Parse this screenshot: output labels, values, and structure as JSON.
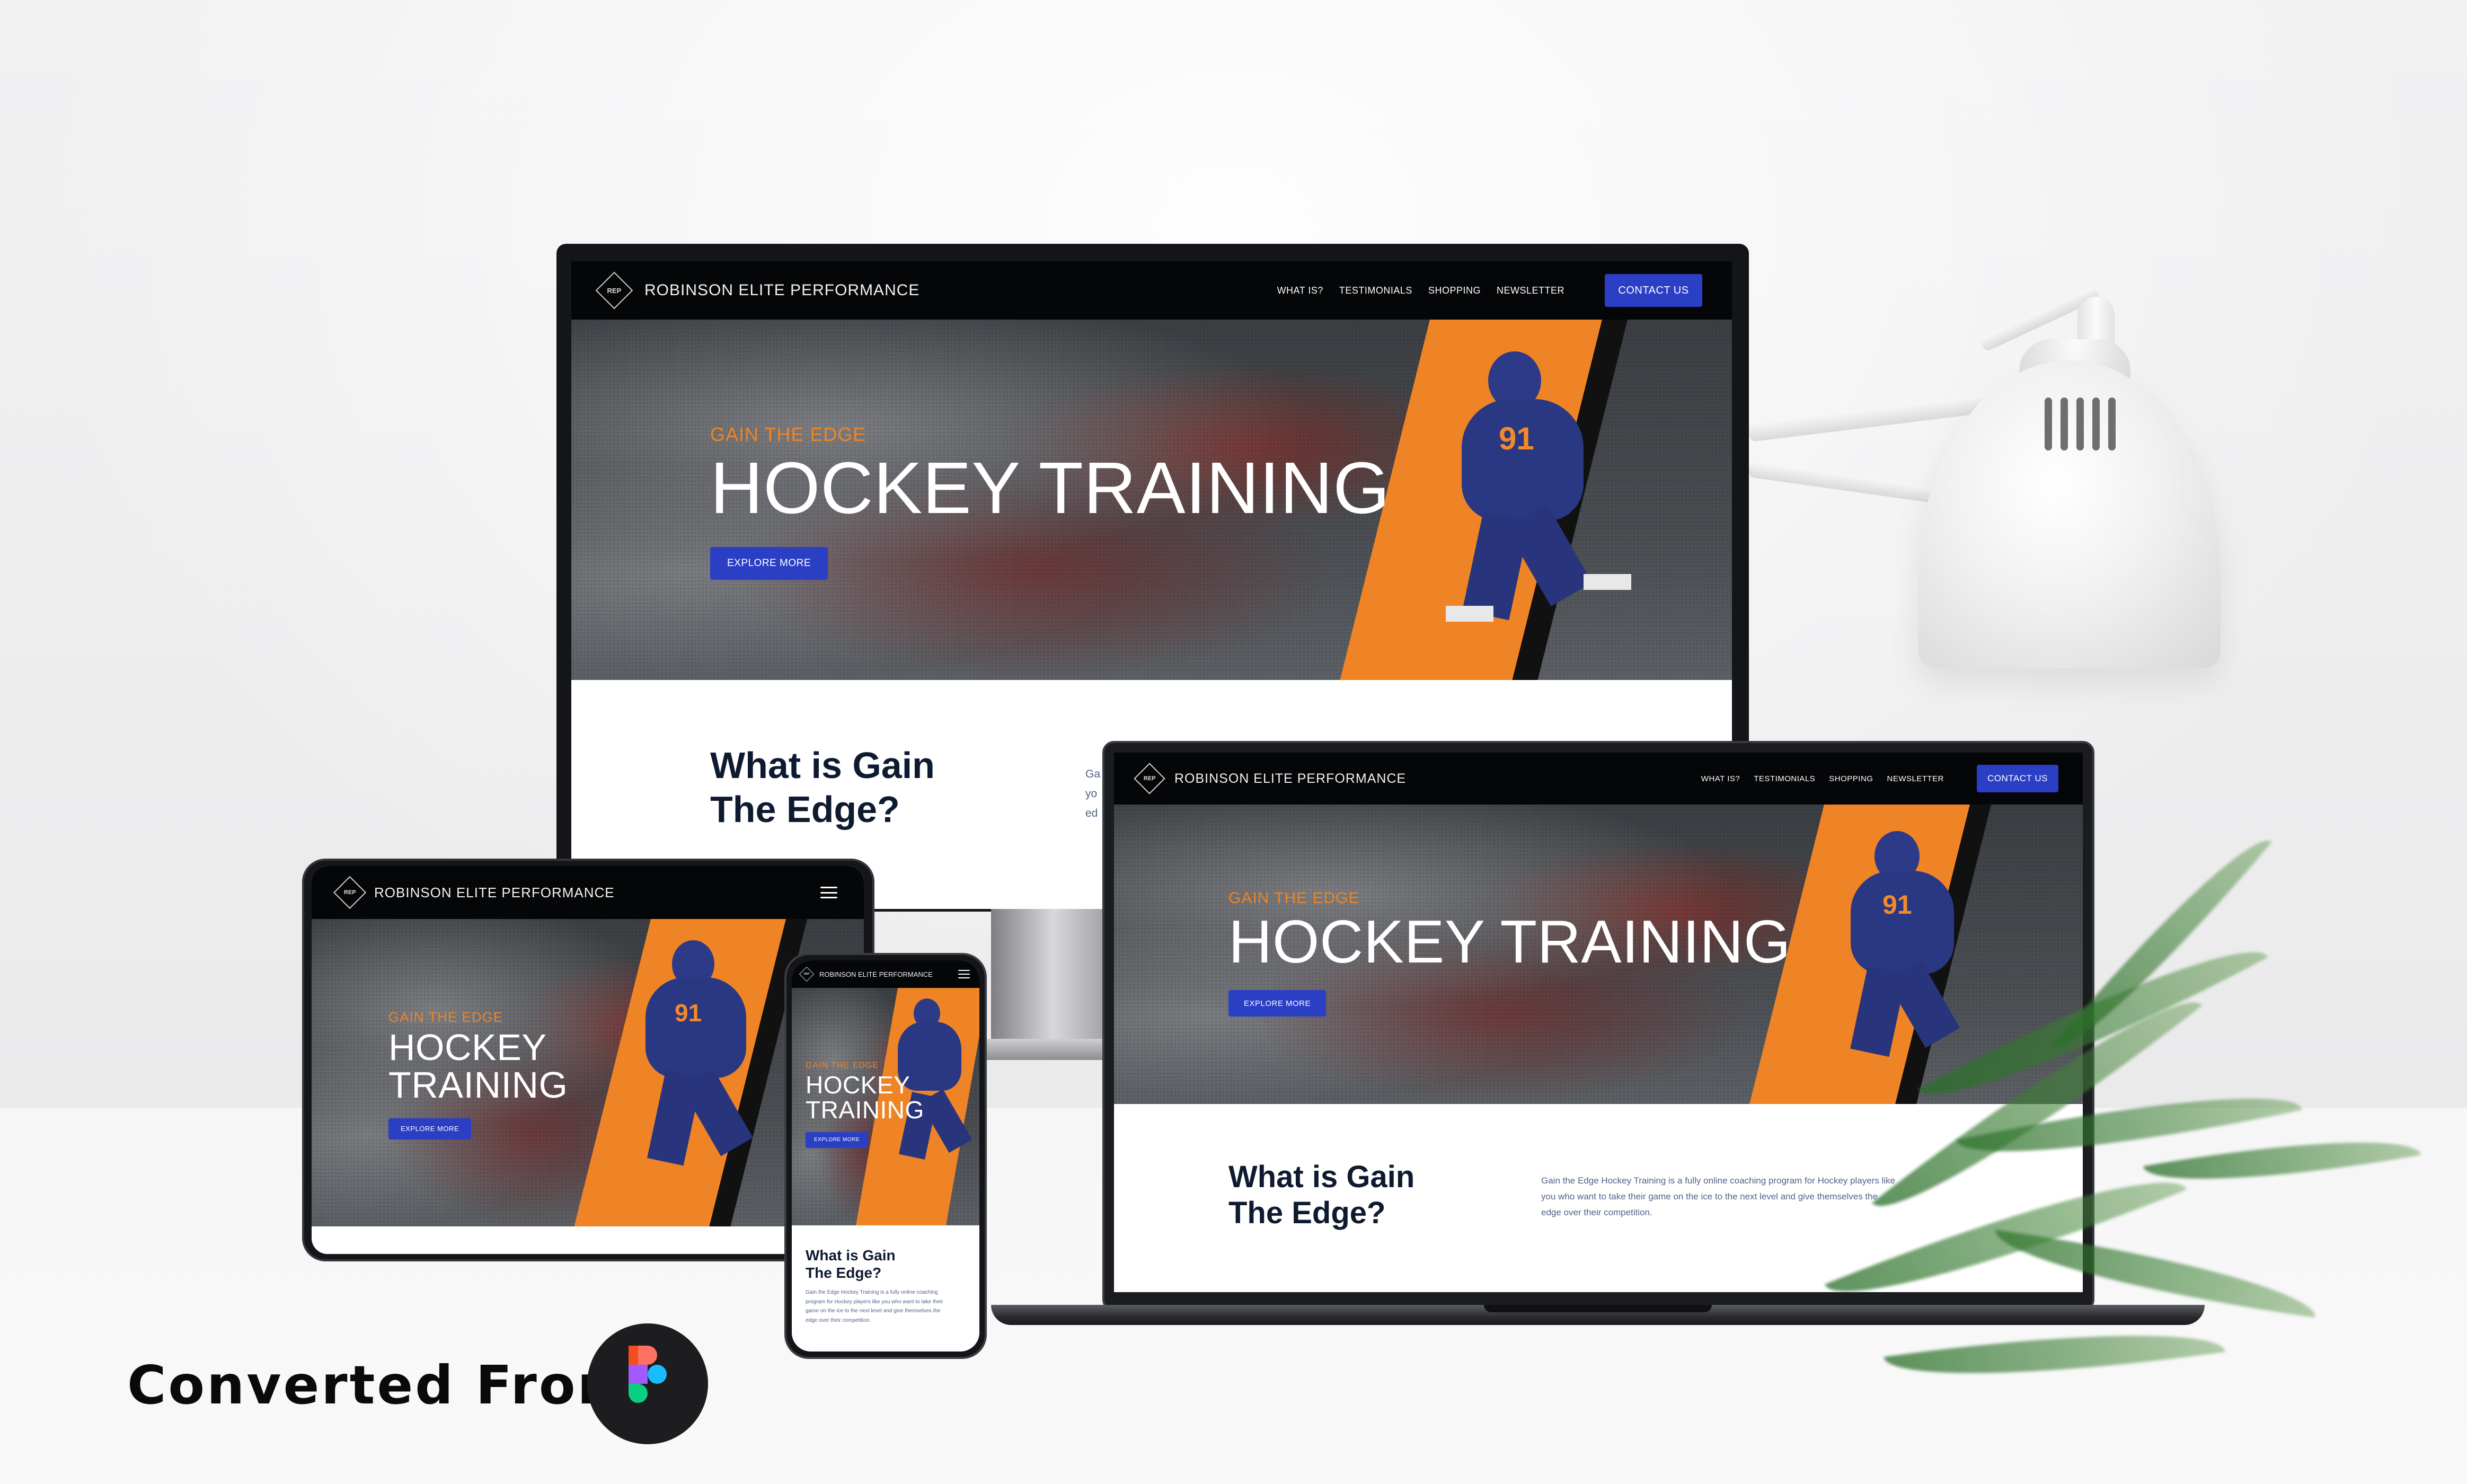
{
  "badge": {
    "text": "Converted From",
    "tool_icon": "figma-icon"
  },
  "site": {
    "brand_name": "ROBINSON ELITE PERFORMANCE",
    "logo_letters": "REP",
    "menu": [
      "WHAT IS?",
      "TESTIMONIALS",
      "SHOPPING",
      "NEWSLETTER"
    ],
    "contact_label": "CONTACT US",
    "hero": {
      "eyebrow": "GAIN THE EDGE",
      "title": "HOCKEY TRAINING",
      "title_line1": "HOCKEY",
      "title_line2": "TRAINING",
      "cta": "EXPLORE MORE",
      "jersey_number": "91",
      "stripe_text": "GAIN THE EDGE"
    },
    "about": {
      "title_line1": "What is Gain",
      "title_line2": "The Edge?",
      "body_line1": "Gain the Edge Hockey Training is a fully online coaching program for Hockey players like",
      "body_line2": "you who want to take their game on the ice to the next level and give themselves the",
      "body_line3": "edge over their competition.",
      "monitor_fragment_1": "Ga",
      "monitor_fragment_2": "yo",
      "monitor_fragment_3": "ed",
      "phone_body_1": "Gain the Edge Hockey Training is a fully online coaching",
      "phone_body_2": "program for Hockey players like you who want to take their",
      "phone_body_3": "game on the ice to the next level and give themselves the",
      "phone_body_4": "edge over their competition."
    }
  },
  "colors": {
    "accent_blue": "#2b3fc5",
    "accent_orange": "#ee8426",
    "nav_black": "#050608",
    "heading_navy": "#0e1a2f",
    "body_text": "#53628a"
  }
}
